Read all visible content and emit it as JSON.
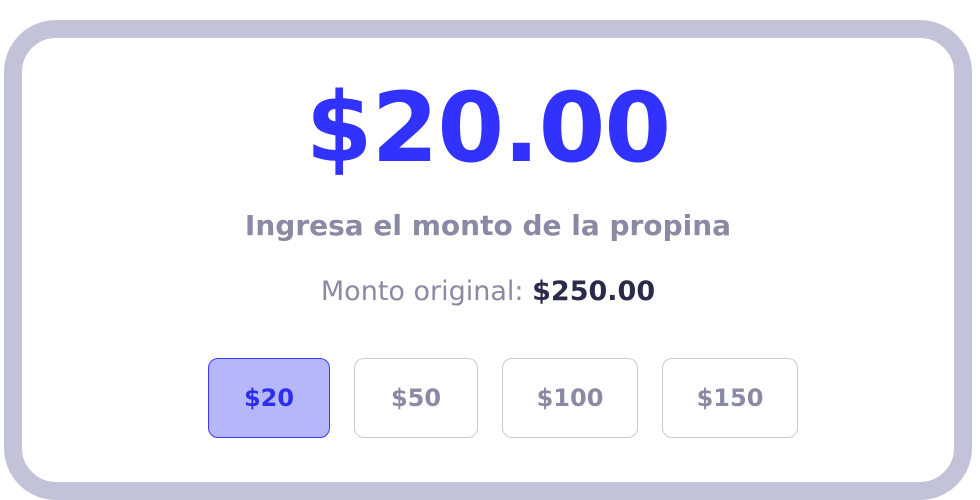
{
  "tip": {
    "amount_display": "$20.00",
    "instruction": "Ingresa el monto de la propina",
    "original_label": "Monto original:",
    "original_value": "$250.00"
  },
  "presets": [
    {
      "label": "$20",
      "selected": true
    },
    {
      "label": "$50",
      "selected": false
    },
    {
      "label": "$100",
      "selected": false
    },
    {
      "label": "$150",
      "selected": false
    }
  ],
  "colors": {
    "accent": "#3232ff",
    "card_border": "#c2c2d8",
    "muted_text": "#8a8aa4",
    "dark_text": "#2a2a4a",
    "selected_bg": "#b6b6fb"
  }
}
